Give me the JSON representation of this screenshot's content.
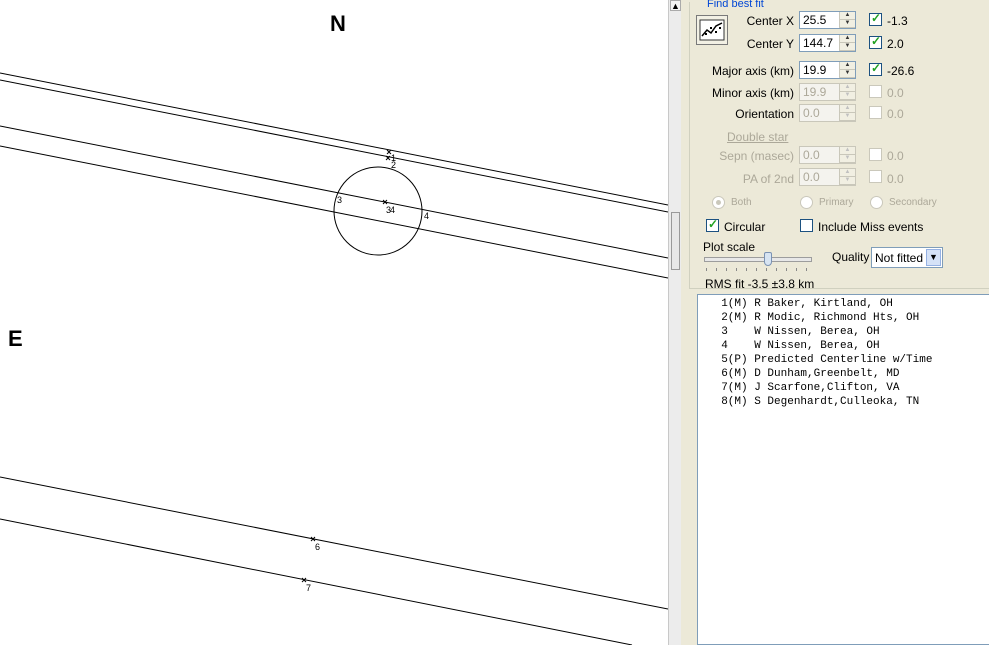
{
  "plot": {
    "north_label": "N",
    "east_label": "E",
    "chord_labels": [
      "1",
      "2",
      "3",
      "3",
      "4",
      "4",
      "6",
      "7"
    ]
  },
  "panel": {
    "group_title": "Find best fit",
    "fit_icon": "chart-fit-icon",
    "center_x": {
      "label": "Center X",
      "value": "25.5",
      "checked": true,
      "offset": "-1.3"
    },
    "center_y": {
      "label": "Center Y",
      "value": "144.7",
      "checked": true,
      "offset": "2.0"
    },
    "major_axis": {
      "label": "Major axis (km)",
      "value": "19.9",
      "checked": true,
      "offset": "-26.6"
    },
    "minor_axis": {
      "label": "Minor axis (km)",
      "value": "19.9",
      "checked": false,
      "offset": "0.0"
    },
    "orientation": {
      "label": "Orientation",
      "value": "0.0",
      "checked": false,
      "offset": "0.0"
    },
    "double_star": "Double star",
    "sepn": {
      "label": "Sepn (masec)",
      "value": "0.0",
      "checked": false,
      "offset": "0.0"
    },
    "pa2": {
      "label": "PA of 2nd",
      "value": "0.0",
      "checked": false,
      "offset": "0.0"
    },
    "radio_options": [
      "Both",
      "Primary",
      "Secondary"
    ],
    "circular": {
      "label": "Circular",
      "checked": true
    },
    "include_miss": {
      "label": "Include Miss events",
      "checked": false
    },
    "plot_scale_label": "Plot scale",
    "plot_scale_level": 0.62,
    "quality_label": "Quality",
    "quality_value": "Not fitted",
    "rms_fit": "RMS fit -3.5 ±3.8 km"
  },
  "observers": [
    "  1(M) R Baker, Kirtland, OH",
    "  2(M) R Modic, Richmond Hts, OH",
    "  3    W Nissen, Berea, OH",
    "  4    W Nissen, Berea, OH",
    "  5(P) Predicted Centerline w/Time",
    "  6(M) D Dunham,Greenbelt, MD",
    "  7(M) J Scarfone,Clifton, VA",
    "  8(M) S Degenhardt,Culleoka, TN"
  ],
  "colors": {
    "link_blue": "#0046d5",
    "panel_bg": "#ece9d8",
    "check_green": "#21a121"
  }
}
